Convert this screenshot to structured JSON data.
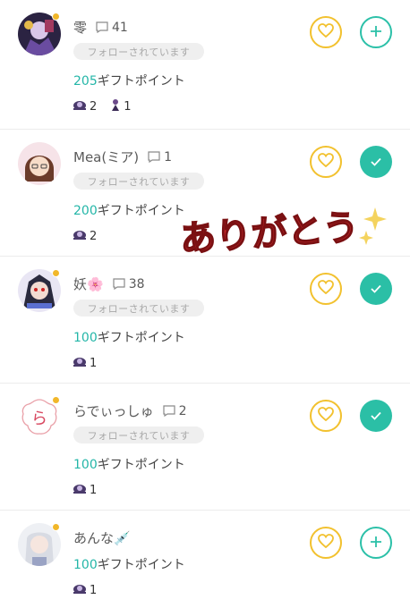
{
  "colors": {
    "accent": "#24b6a8",
    "heart": "#f2c12e",
    "followed": "#2bbfa6",
    "sticker": "#c7272a"
  },
  "badge_text": "フォローされています",
  "points_suffix": "ギフトポイント",
  "sticker_text": "ありがとう",
  "users": [
    {
      "name": "零",
      "comments": "41",
      "followed_by": true,
      "points": "205",
      "gifts": [
        {
          "icon": "snail-gift-icon",
          "count": "2"
        },
        {
          "icon": "figure-gift-icon",
          "count": "1"
        }
      ],
      "following": false
    },
    {
      "name": "Mea(ミア)",
      "comments": "1",
      "followed_by": true,
      "points": "200",
      "gifts": [
        {
          "icon": "snail-gift-icon",
          "count": "2"
        }
      ],
      "following": true
    },
    {
      "name": "妖🌸",
      "comments": "38",
      "followed_by": true,
      "points": "100",
      "gifts": [
        {
          "icon": "snail-gift-icon",
          "count": "1"
        }
      ],
      "following": true
    },
    {
      "name": "らでぃっしゅ",
      "comments": "2",
      "followed_by": true,
      "points": "100",
      "gifts": [
        {
          "icon": "snail-gift-icon",
          "count": "1"
        }
      ],
      "following": true
    },
    {
      "name": "あんな💉",
      "comments": "",
      "followed_by": false,
      "points": "100",
      "gifts": [
        {
          "icon": "snail-gift-icon",
          "count": "1"
        }
      ],
      "following": false
    }
  ]
}
